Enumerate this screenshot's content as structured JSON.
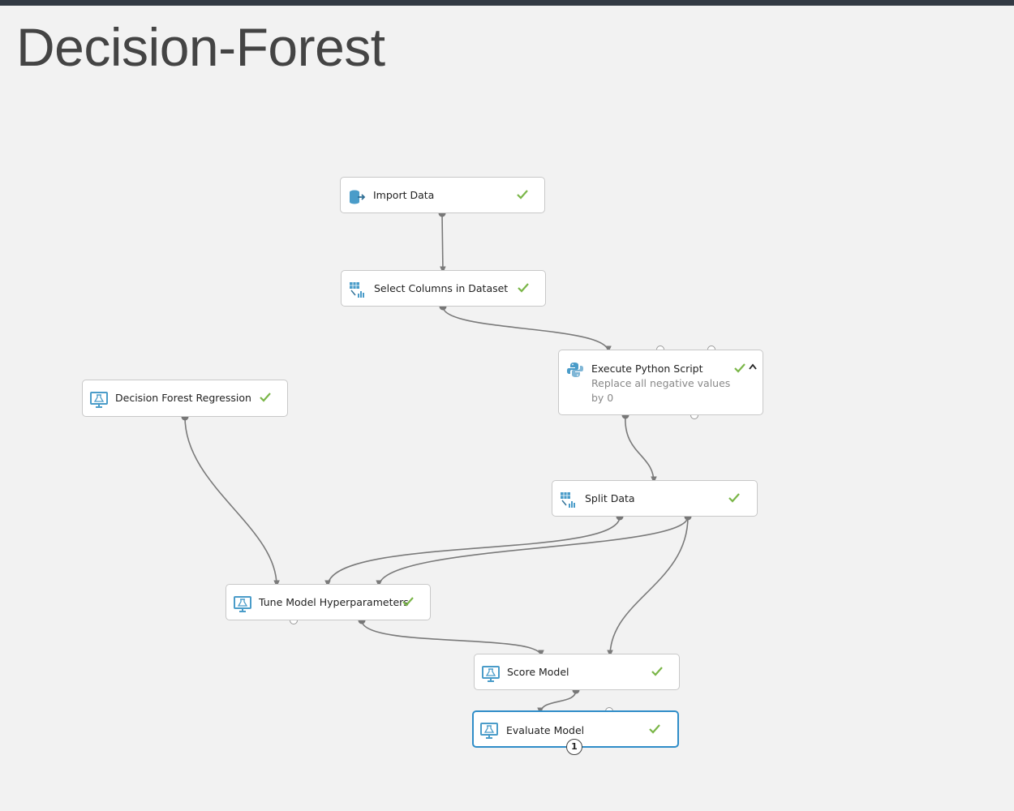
{
  "experiment": {
    "title": "Decision-Forest"
  },
  "colors": {
    "accent": "#2f8dc8",
    "check": "#7ab648",
    "edge": "#7a7a7a",
    "icon": "#4a9cc9"
  },
  "modules": {
    "import_data": {
      "label": "Import Data",
      "icon": "database-icon",
      "status": "completed"
    },
    "select_columns": {
      "label": "Select Columns in Dataset",
      "icon": "table-transform-icon",
      "status": "completed"
    },
    "execute_python": {
      "label": "Execute Python Script",
      "comment": "Replace all negative values by 0",
      "icon": "python-icon",
      "status": "completed"
    },
    "decision_forest": {
      "label": "Decision Forest Regression",
      "icon": "monitor-flask-icon",
      "status": "completed"
    },
    "split_data": {
      "label": "Split Data",
      "icon": "table-transform-icon",
      "status": "completed"
    },
    "tune_model": {
      "label": "Tune Model Hyperparameters",
      "icon": "monitor-flask-icon",
      "status": "completed"
    },
    "score_model": {
      "label": "Score Model",
      "icon": "monitor-flask-icon",
      "status": "completed"
    },
    "evaluate_model": {
      "label": "Evaluate Model",
      "icon": "monitor-flask-icon",
      "status": "completed",
      "selected": true,
      "badge": "1"
    }
  }
}
